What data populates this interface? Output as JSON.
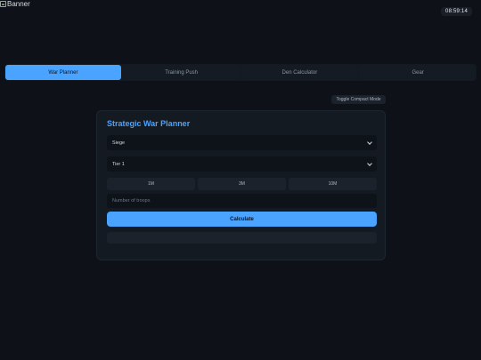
{
  "banner": {
    "alt_text": "Banner"
  },
  "clock": {
    "time": "08:59:14"
  },
  "tabs": [
    {
      "label": "War Planner",
      "active": true
    },
    {
      "label": "Training Push",
      "active": false
    },
    {
      "label": "Den Calculator",
      "active": false
    },
    {
      "label": "Gear",
      "active": false
    }
  ],
  "compact_toggle": {
    "label": "Toggle Compact Mode"
  },
  "planner": {
    "title": "Strategic War Planner",
    "type_select": {
      "value": "Siege"
    },
    "tier_select": {
      "value": "Tier 1"
    },
    "presets": [
      "1M",
      "3M",
      "10M"
    ],
    "troops_input": {
      "placeholder": "Number of troops",
      "value": ""
    },
    "calculate_label": "Calculate",
    "result": ""
  },
  "colors": {
    "accent": "#4aa3ff",
    "background": "#0e1218",
    "card": "#141a22"
  }
}
